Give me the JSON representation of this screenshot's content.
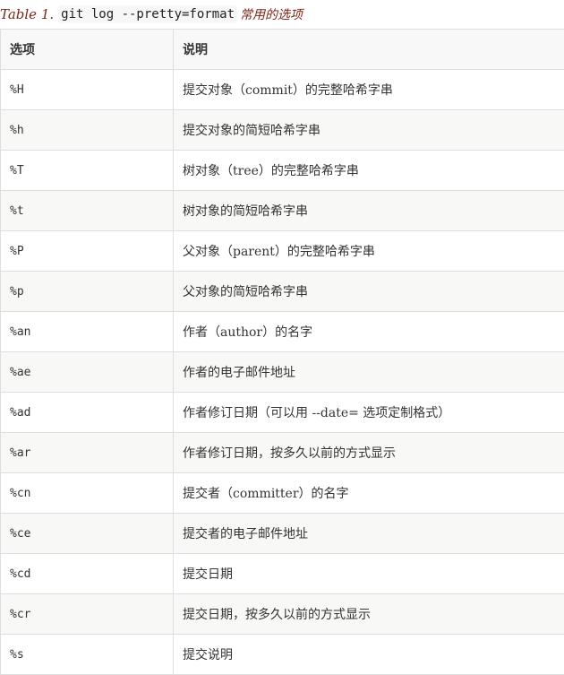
{
  "caption": {
    "label": "Table 1.",
    "command": "git log --pretty=format",
    "suffix": "常用的选项"
  },
  "table": {
    "headers": [
      "选项",
      "说明"
    ],
    "rows": [
      {
        "option": "%H",
        "description": "提交对象（commit）的完整哈希字串"
      },
      {
        "option": "%h",
        "description": "提交对象的简短哈希字串"
      },
      {
        "option": "%T",
        "description": "树对象（tree）的完整哈希字串"
      },
      {
        "option": "%t",
        "description": "树对象的简短哈希字串"
      },
      {
        "option": "%P",
        "description": "父对象（parent）的完整哈希字串"
      },
      {
        "option": "%p",
        "description": "父对象的简短哈希字串"
      },
      {
        "option": "%an",
        "description": "作者（author）的名字"
      },
      {
        "option": "%ae",
        "description": "作者的电子邮件地址"
      },
      {
        "option": "%ad",
        "description": "作者修订日期（可以用 --date= 选项定制格式）"
      },
      {
        "option": "%ar",
        "description": "作者修订日期，按多久以前的方式显示"
      },
      {
        "option": "%cn",
        "description": "提交者（committer）的名字"
      },
      {
        "option": "%ce",
        "description": "提交者的电子邮件地址"
      },
      {
        "option": "%cd",
        "description": "提交日期"
      },
      {
        "option": "%cr",
        "description": "提交日期，按多久以前的方式显示"
      },
      {
        "option": "%s",
        "description": "提交说明"
      }
    ]
  }
}
